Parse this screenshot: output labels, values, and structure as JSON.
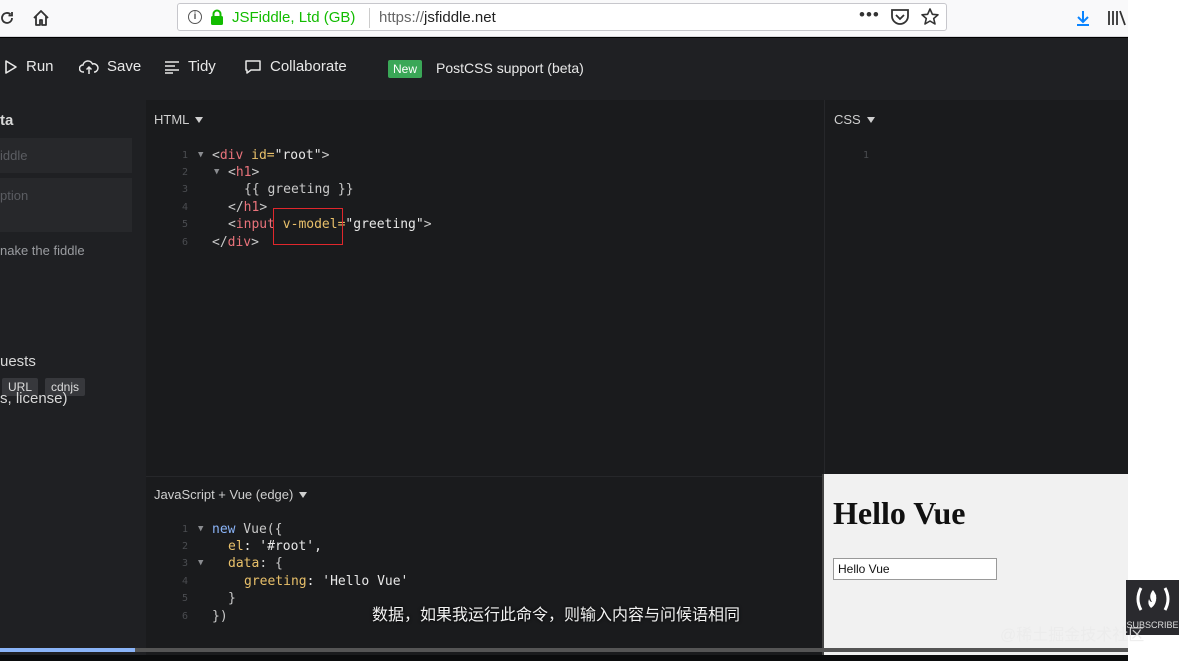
{
  "browser": {
    "url_org": "JSFiddle, Ltd (GB)",
    "url_scheme": "https://",
    "url_host": "jsfiddle.net",
    "menu_dots": "•••"
  },
  "toolbar": {
    "run": "Run",
    "save": "Save",
    "tidy": "Tidy",
    "collaborate": "Collaborate",
    "new_badge": "New",
    "announcement": "PostCSS support (beta)"
  },
  "sidebar": {
    "heading": "ta",
    "title_placeholder": "iddle",
    "desc_placeholder": "ption",
    "make_fiddle": "nake the fiddle",
    "tag_url": "URL",
    "tag_cdnjs": "cdnjs",
    "requests": "uests",
    "license": "s, license)"
  },
  "html_panel": {
    "label": "HTML",
    "line_numbers": [
      "1",
      "2",
      "3",
      "4",
      "5",
      "6"
    ]
  },
  "css_panel": {
    "label": "CSS",
    "line_numbers": [
      "1"
    ]
  },
  "js_panel": {
    "label": "JavaScript + Vue (edge)",
    "line_numbers": [
      "1",
      "2",
      "3",
      "4",
      "5",
      "6"
    ]
  },
  "code_html": {
    "l1_open": "<",
    "l1_tag": "div",
    "l1_attr": " id=",
    "l1_val": "\"root\"",
    "l1_close": ">",
    "l2_open": "<",
    "l2_tag": "h1",
    "l2_close": ">",
    "l3_text": "{{ greeting }}",
    "l4_open": "</",
    "l4_tag": "h1",
    "l4_close": ">",
    "l5_open": "<",
    "l5_tag": "input",
    "l5_attr": " v-model=",
    "l5_val": "\"greeting\"",
    "l5_close": ">",
    "l6_open": "</",
    "l6_tag": "div",
    "l6_close": ">"
  },
  "code_js": {
    "l1_kw": "new",
    "l1_rest": " Vue({",
    "l2_prop": "el",
    "l2_rest": ": '#root',",
    "l3_prop": "data",
    "l3_rest": ": {",
    "l4_prop": "greeting",
    "l4_rest": ": 'Hello Vue'",
    "l5": "}",
    "l6": "})"
  },
  "result": {
    "heading": "Hello Vue",
    "input_value": "Hello Vue"
  },
  "overlay": {
    "subtitle": "数据，如果我运行此命令，则输入内容与问候语相同",
    "watermark": "@稀土掘金技术社区",
    "subscribe": "SUBSCRIBE"
  },
  "video": {
    "progress_fraction": 0.12
  },
  "colors": {
    "highlight_box": "#e0272c",
    "new_badge": "#3aa757",
    "secure_green": "#12bc00"
  }
}
